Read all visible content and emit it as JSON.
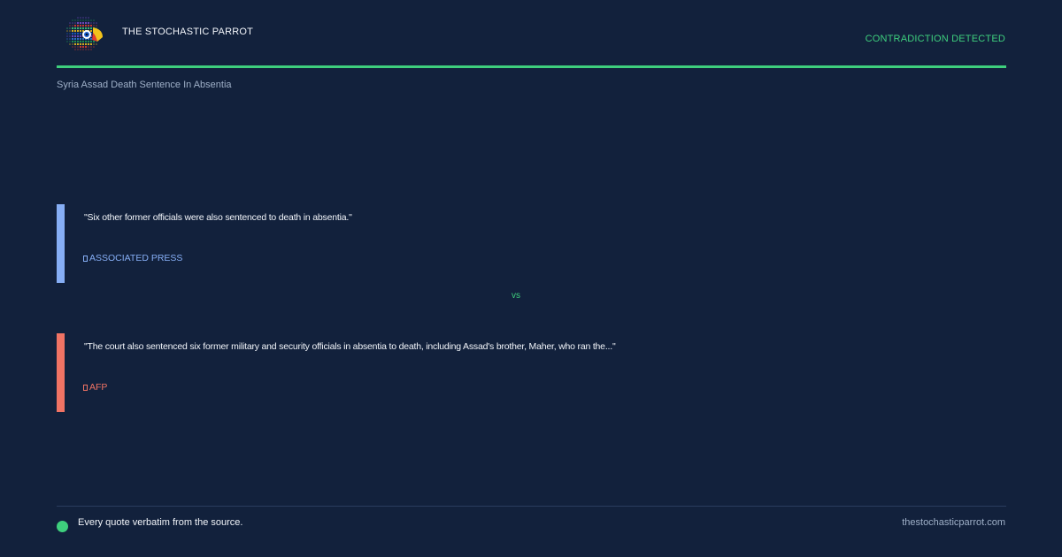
{
  "header": {
    "logo_icon": "parrot-logo-icon",
    "brand": "THE STOCHASTIC PARROT",
    "status": "CONTRADICTION DETECTED"
  },
  "topic": "Syria Assad Death Sentence In Absentia",
  "quotes": [
    {
      "text": "\"Six other former officials were also sentenced to death in absentia.\"",
      "source": "ASSOCIATED PRESS",
      "color": "#86aef5"
    },
    {
      "text": "\"The court also sentenced six former military and security officials in absentia to death, including Assad's brother, Maher, who ran the...\"",
      "source": "AFP",
      "color": "#f07364"
    }
  ],
  "vs_label": "vs",
  "footer": {
    "note": "Every quote verbatim from the source.",
    "site": "thestochasticparrot.com"
  },
  "colors": {
    "background": "#12213c",
    "accent": "#3ecf7d"
  }
}
